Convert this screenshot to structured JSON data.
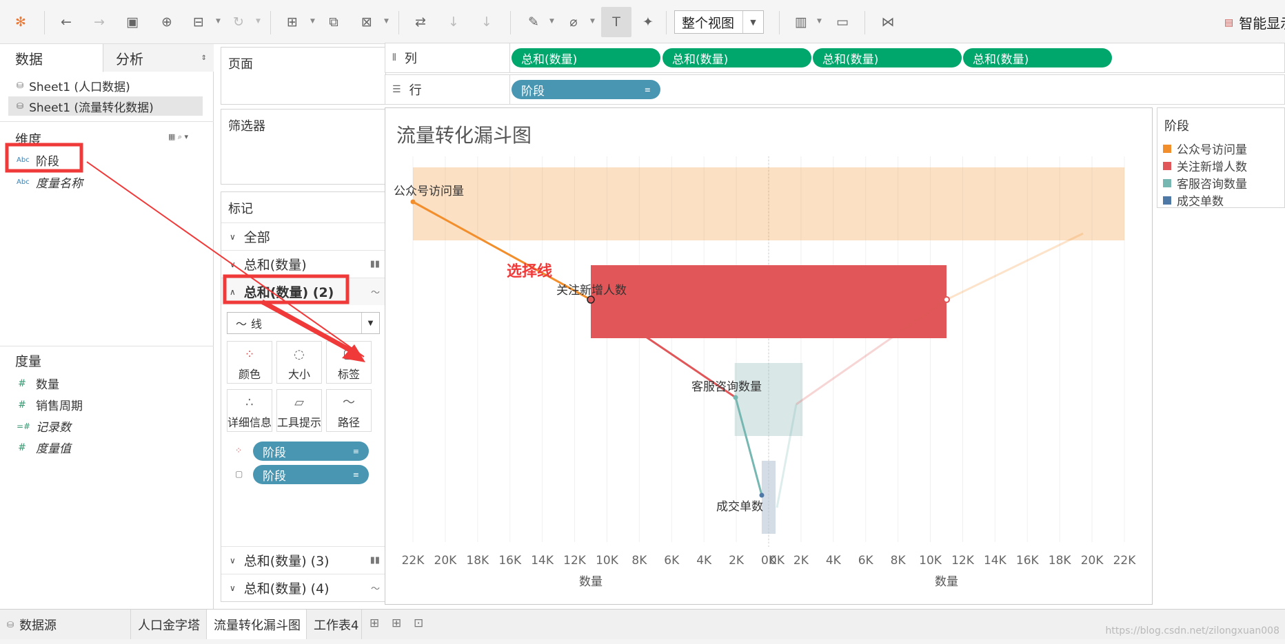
{
  "toolbar": {
    "icons": [
      "tableau-logo-icon",
      "undo-icon",
      "redo-icon",
      "save-icon",
      "new-datasource-icon",
      "pause-update-icon",
      "refresh-icon",
      "new-worksheet-icon",
      "duplicate-icon",
      "clear-sheet-icon",
      "swap-icon",
      "sort-asc-icon",
      "sort-desc-icon",
      "highlight-icon",
      "group-icon",
      "show-labels-icon",
      "pin-icon",
      "show-me-icon",
      "presentation-icon",
      "share-icon"
    ],
    "view_mode": "整个视图",
    "smart_display": "智能显示"
  },
  "data_pane": {
    "tabs": [
      "数据",
      "分析"
    ],
    "sources": [
      "Sheet1 (人口数据)",
      "Sheet1 (流量转化数据)"
    ],
    "dimensions_title": "维度",
    "dimensions": [
      {
        "type": "Abc",
        "label": "阶段",
        "italic": false
      },
      {
        "type": "Abc",
        "label": "度量名称",
        "italic": true
      }
    ],
    "measures_title": "度量",
    "measures": [
      {
        "type": "#",
        "label": "数量",
        "italic": false
      },
      {
        "type": "#",
        "label": "销售周期",
        "italic": false
      },
      {
        "type": "=#",
        "label": "记录数",
        "italic": true
      },
      {
        "type": "#",
        "label": "度量值",
        "italic": true
      }
    ]
  },
  "cards": {
    "pages": "页面",
    "filters": "筛选器",
    "marks": "标记",
    "mark_rows": [
      "全部",
      "总和(数量)",
      "总和(数量) (2)",
      "总和(数量) (3)",
      "总和(数量) (4)"
    ],
    "mark_type": "线",
    "mark_buttons": [
      "颜色",
      "大小",
      "标签",
      "详细信息",
      "工具提示",
      "路径"
    ],
    "encodings": [
      {
        "kind": "color",
        "field": "阶段"
      },
      {
        "kind": "label",
        "field": "阶段"
      }
    ]
  },
  "shelves": {
    "columns_label": "列",
    "columns_pills": [
      "总和(数量)",
      "总和(数量)",
      "总和(数量)",
      "总和(数量)"
    ],
    "rows_label": "行",
    "rows_pills": [
      "阶段"
    ]
  },
  "annotation": {
    "callout": "选择线",
    "highlight_color": "#f03a3a"
  },
  "chart_data": {
    "type": "bar",
    "title": "流量转化漏斗图",
    "categories": [
      "公众号访问量",
      "关注新增人数",
      "客服咨询数量",
      "成交单数"
    ],
    "values": [
      22000,
      11000,
      2100,
      430
    ],
    "colors": [
      "#f28e2b",
      "#e15759",
      "#76b7b2",
      "#4e79a7"
    ],
    "x_ticks_left": [
      "22K",
      "20K",
      "18K",
      "16K",
      "14K",
      "12K",
      "10K",
      "8K",
      "6K",
      "4K",
      "2K",
      "0K"
    ],
    "x_ticks_right": [
      "0K",
      "2K",
      "4K",
      "6K",
      "8K",
      "10K",
      "12K",
      "14K",
      "16K",
      "18K",
      "20K",
      "22K"
    ],
    "xlabel_left": "数量",
    "xlabel_right": "数量",
    "xlim": [
      0,
      22000
    ]
  },
  "legend": {
    "title": "阶段",
    "items": [
      {
        "label": "公众号访问量",
        "color": "#f28e2b"
      },
      {
        "label": "关注新增人数",
        "color": "#e15759"
      },
      {
        "label": "客服咨询数量",
        "color": "#76b7b2"
      },
      {
        "label": "成交单数",
        "color": "#4e79a7"
      }
    ]
  },
  "bottom_tabs": {
    "datasource": "数据源",
    "sheets": [
      "人口金字塔",
      "流量转化漏斗图",
      "工作表4"
    ],
    "active": "流量转化漏斗图"
  },
  "watermark": "https://blog.csdn.net/zilongxuan008"
}
